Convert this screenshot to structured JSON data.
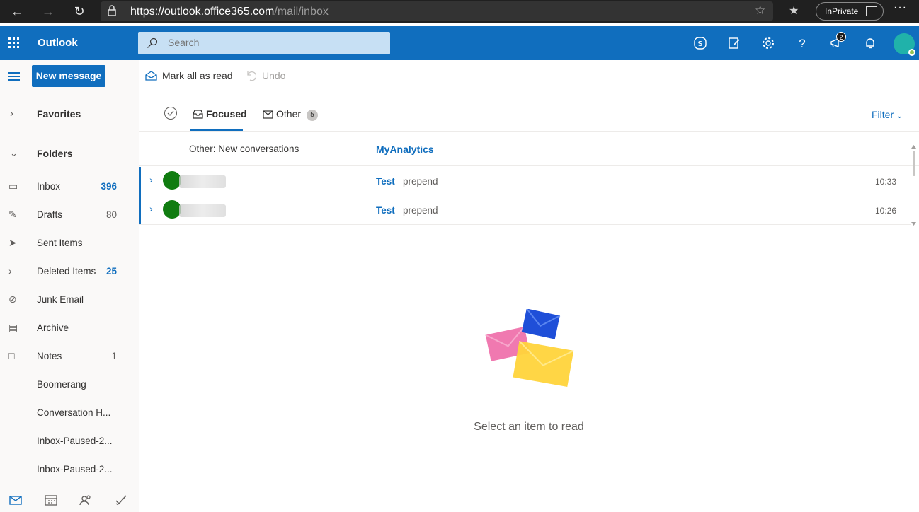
{
  "browser": {
    "url_host": "https://outlook.office365.com",
    "url_path": "/mail/inbox",
    "inprivate_label": "InPrivate",
    "more_label": "···"
  },
  "header": {
    "app_name": "Outlook",
    "search_placeholder": "Search",
    "notification_count": "2"
  },
  "sidebar": {
    "new_message_label": "New message",
    "favorites_label": "Favorites",
    "folders_label": "Folders",
    "folders": [
      {
        "label": "Inbox",
        "count": "396",
        "icon": "inbox-icon"
      },
      {
        "label": "Drafts",
        "count": "80",
        "icon": "pencil-icon"
      },
      {
        "label": "Sent Items",
        "count": "",
        "icon": "send-icon"
      },
      {
        "label": "Deleted Items",
        "count": "25",
        "icon": "chevron-right-icon"
      },
      {
        "label": "Junk Email",
        "count": "",
        "icon": "block-icon"
      },
      {
        "label": "Archive",
        "count": "",
        "icon": "archive-icon"
      },
      {
        "label": "Notes",
        "count": "1",
        "icon": "note-icon"
      },
      {
        "label": "Boomerang",
        "count": ""
      },
      {
        "label": "Conversation H...",
        "count": ""
      },
      {
        "label": "Inbox-Paused-2...",
        "count": ""
      },
      {
        "label": "Inbox-Paused-2...",
        "count": ""
      }
    ]
  },
  "command_bar": {
    "mark_all_read": "Mark all as read",
    "undo": "Undo"
  },
  "message_list": {
    "focused_label": "Focused",
    "other_label": "Other",
    "other_count": "5",
    "filter_label": "Filter",
    "other_notice": "Other: New conversations",
    "other_notice_sender": "MyAnalytics",
    "messages": [
      {
        "subject": "Test",
        "preview": "prepend",
        "time": "10:33"
      },
      {
        "subject": "Test",
        "preview": "prepend",
        "time": "10:26"
      }
    ]
  },
  "reading_pane": {
    "empty_text": "Select an item to read"
  },
  "colors": {
    "brand": "#106ebe",
    "header_bg": "#106ebe",
    "avatar_green": "#107c10"
  }
}
